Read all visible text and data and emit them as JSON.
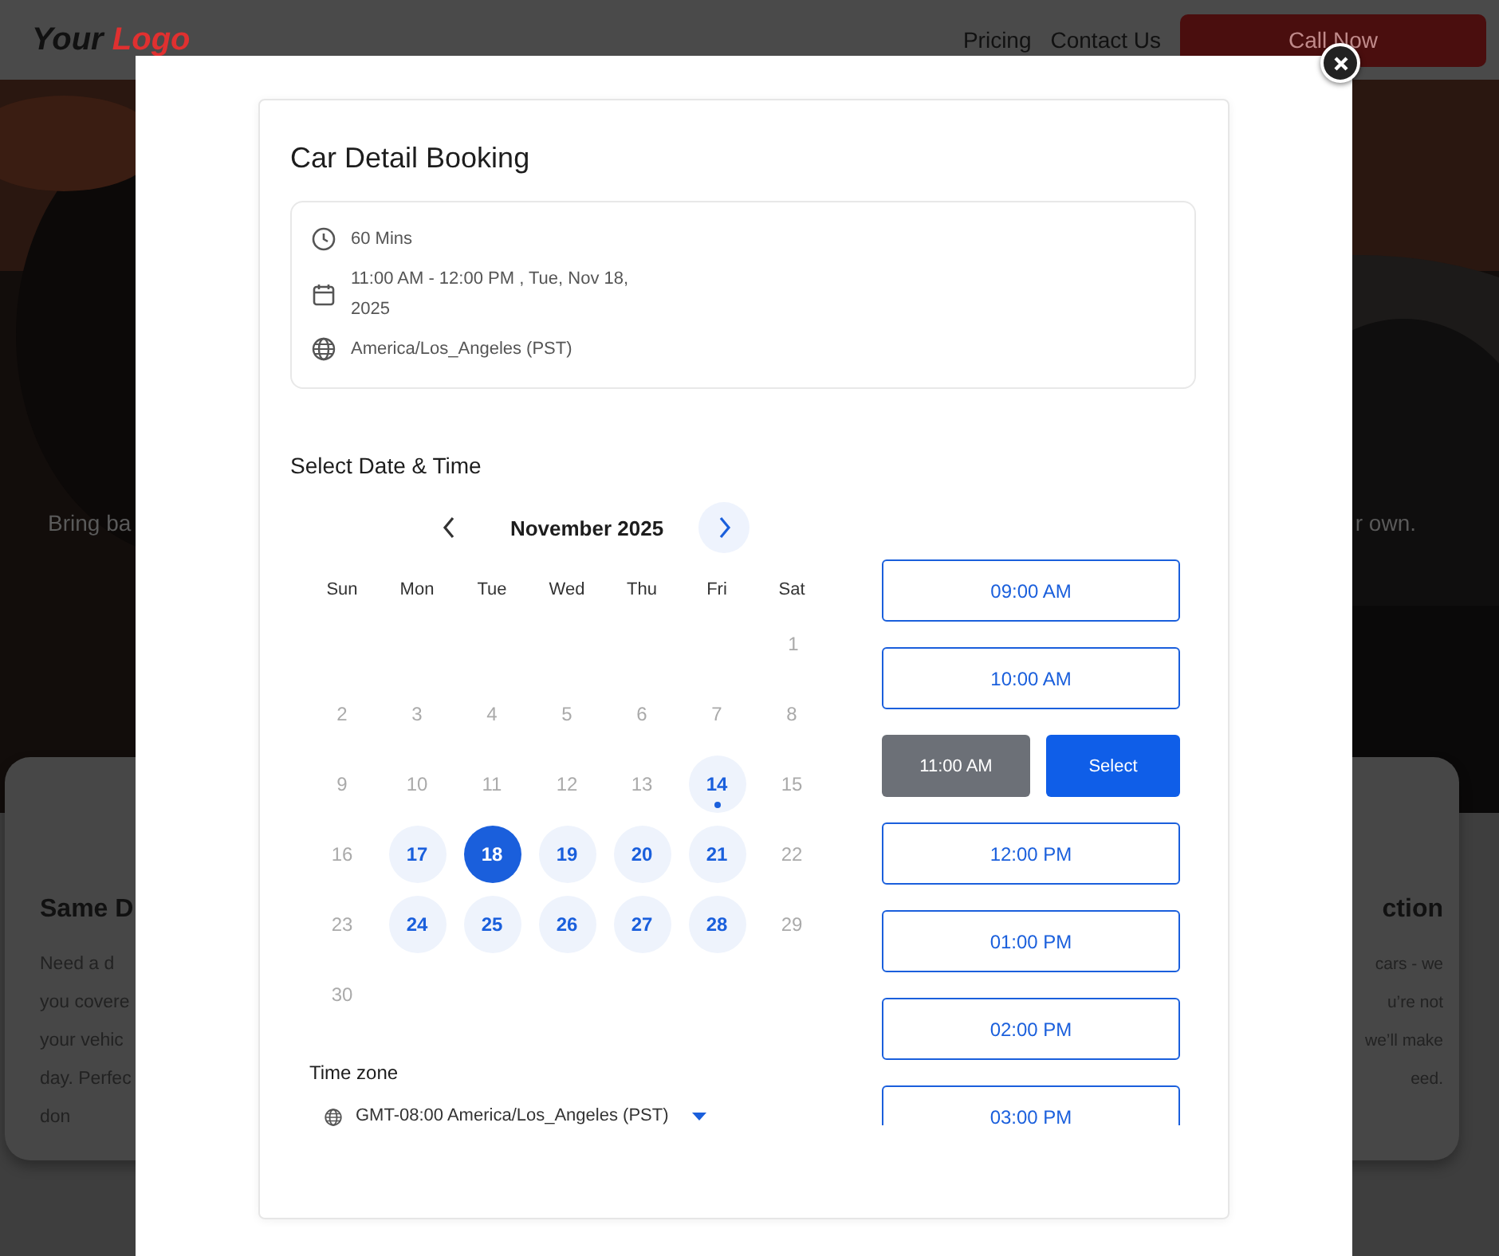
{
  "site": {
    "logo_words": [
      "Your",
      "Logo"
    ],
    "nav": [
      "Pricing",
      "Contact Us"
    ],
    "cta": "Call Now",
    "hero_left": "Bring ba",
    "hero_right": "r own.",
    "cards": [
      {
        "kind": "leading",
        "title": "Same D",
        "lines": [
          "Need a d",
          "you covere",
          "your vehic",
          "day. Perfec",
          "don"
        ]
      },
      {
        "kind": "trailing",
        "title": "ction",
        "lines": [
          "cars - we",
          "u’re not",
          "we’ll make",
          "eed."
        ]
      }
    ]
  },
  "booking": {
    "title": "Car Detail Booking",
    "summary": [
      {
        "kind": "duration",
        "text": "60 Mins"
      },
      {
        "kind": "date",
        "text": "11:00 AM - 12:00 PM , Tue, Nov 18, 2025"
      },
      {
        "kind": "timezone",
        "text": "America/Los_Angeles (PST)"
      }
    ],
    "section_title": "Select Date & Time",
    "calendar": {
      "month": "November 2025",
      "weekdays": [
        "Sun",
        "Mon",
        "Tue",
        "Wed",
        "Thu",
        "Fri",
        "Sat"
      ],
      "weeks": [
        {
          "kind": "leading",
          "days": [
            {
              "label": "1",
              "available": false,
              "selected": false,
              "marked": false
            }
          ]
        },
        {
          "kind": "full",
          "days": [
            {
              "label": "2",
              "available": false,
              "selected": false,
              "marked": false
            },
            {
              "label": "3",
              "available": false,
              "selected": false,
              "marked": false
            },
            {
              "label": "4",
              "available": false,
              "selected": false,
              "marked": false
            },
            {
              "label": "5",
              "available": false,
              "selected": false,
              "marked": false
            },
            {
              "label": "6",
              "available": false,
              "selected": false,
              "marked": false
            },
            {
              "label": "7",
              "available": false,
              "selected": false,
              "marked": false
            },
            {
              "label": "8",
              "available": false,
              "selected": false,
              "marked": false
            }
          ]
        },
        {
          "kind": "full",
          "days": [
            {
              "label": "9",
              "available": false,
              "selected": false,
              "marked": false
            },
            {
              "label": "10",
              "available": false,
              "selected": false,
              "marked": false
            },
            {
              "label": "11",
              "available": false,
              "selected": false,
              "marked": false
            },
            {
              "label": "12",
              "available": false,
              "selected": false,
              "marked": false
            },
            {
              "label": "13",
              "available": false,
              "selected": false,
              "marked": false
            },
            {
              "label": "14",
              "available": true,
              "selected": false,
              "marked": true
            },
            {
              "label": "15",
              "available": false,
              "selected": false,
              "marked": false
            }
          ]
        },
        {
          "kind": "full",
          "days": [
            {
              "label": "16",
              "available": false,
              "selected": false,
              "marked": false
            },
            {
              "label": "17",
              "available": true,
              "selected": false,
              "marked": false
            },
            {
              "label": "18",
              "available": true,
              "selected": true,
              "marked": false
            },
            {
              "label": "19",
              "available": true,
              "selected": false,
              "marked": false
            },
            {
              "label": "20",
              "available": true,
              "selected": false,
              "marked": false
            },
            {
              "label": "21",
              "available": true,
              "selected": false,
              "marked": false
            },
            {
              "label": "22",
              "available": false,
              "selected": false,
              "marked": false
            }
          ]
        },
        {
          "kind": "full",
          "days": [
            {
              "label": "23",
              "available": false,
              "selected": false,
              "marked": false
            },
            {
              "label": "24",
              "available": true,
              "selected": false,
              "marked": false
            },
            {
              "label": "25",
              "available": true,
              "selected": false,
              "marked": false
            },
            {
              "label": "26",
              "available": true,
              "selected": false,
              "marked": false
            },
            {
              "label": "27",
              "available": true,
              "selected": false,
              "marked": false
            },
            {
              "label": "28",
              "available": true,
              "selected": false,
              "marked": false
            },
            {
              "label": "29",
              "available": false,
              "selected": false,
              "marked": false
            }
          ]
        },
        {
          "kind": "trailing",
          "days": [
            {
              "label": "30",
              "available": false,
              "selected": false,
              "marked": false
            }
          ]
        }
      ]
    },
    "slots": [
      {
        "time": "09:00 AM",
        "selected": false
      },
      {
        "time": "10:00 AM",
        "selected": false
      },
      {
        "time": "11:00 AM",
        "selected": true
      },
      {
        "time": "12:00 PM",
        "selected": false
      },
      {
        "time": "01:00 PM",
        "selected": false
      },
      {
        "time": "02:00 PM",
        "selected": false
      },
      {
        "time": "03:00 PM",
        "selected": false
      }
    ],
    "select_label": "Select",
    "timezone": {
      "label": "Time zone",
      "value": "GMT-08:00 America/Los_Angeles (PST)"
    }
  }
}
